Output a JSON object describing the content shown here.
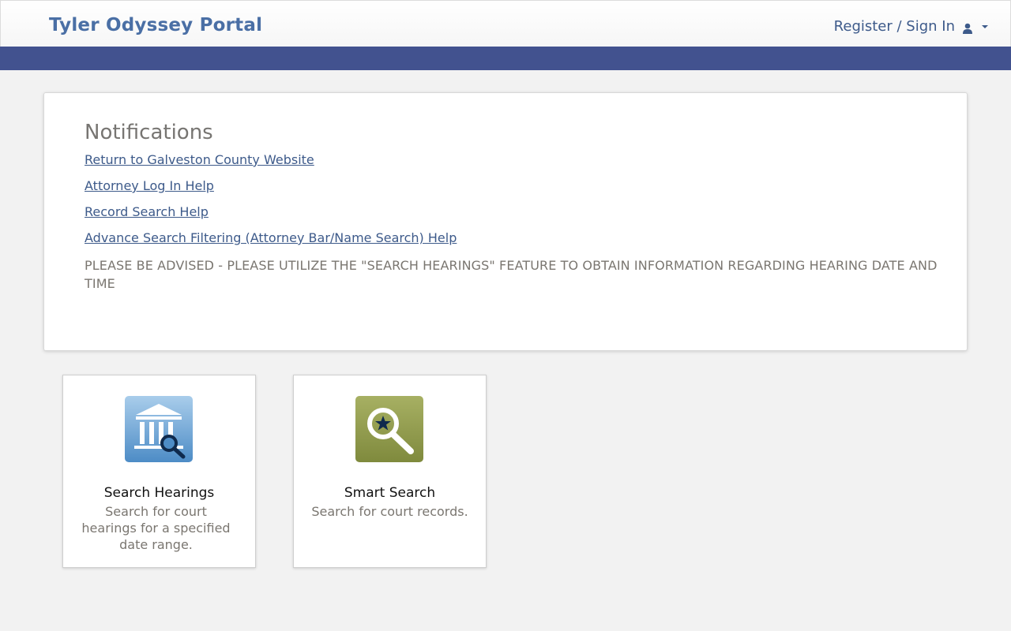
{
  "header": {
    "brand": "Tyler Odyssey Portal",
    "signin_label": "Register / Sign In",
    "user_icon": "user-icon",
    "caret_icon": "caret-down-icon"
  },
  "notifications": {
    "title": "Notifications",
    "links": [
      "Return to Galveston County Website",
      "Attorney Log In Help",
      "Record Search Help",
      "Advance Search Filtering (Attorney Bar/Name Search) Help"
    ],
    "notice": "PLEASE BE ADVISED - PLEASE UTILIZE THE \"SEARCH HEARINGS\" FEATURE TO OBTAIN INFORMATION REGARDING HEARING DATE AND TIME"
  },
  "tiles": [
    {
      "title": "Search Hearings",
      "description": "Search for court hearings for a specified date range.",
      "icon": "courthouse-search-icon"
    },
    {
      "title": "Smart Search",
      "description": "Search for court records.",
      "icon": "magnifier-star-icon"
    }
  ],
  "colors": {
    "brand": "#4a6fa5",
    "bar": "#42528f",
    "link": "#3d5a8a",
    "hearings_tile": "#6aa3d4",
    "smart_tile": "#8f9a4c"
  }
}
